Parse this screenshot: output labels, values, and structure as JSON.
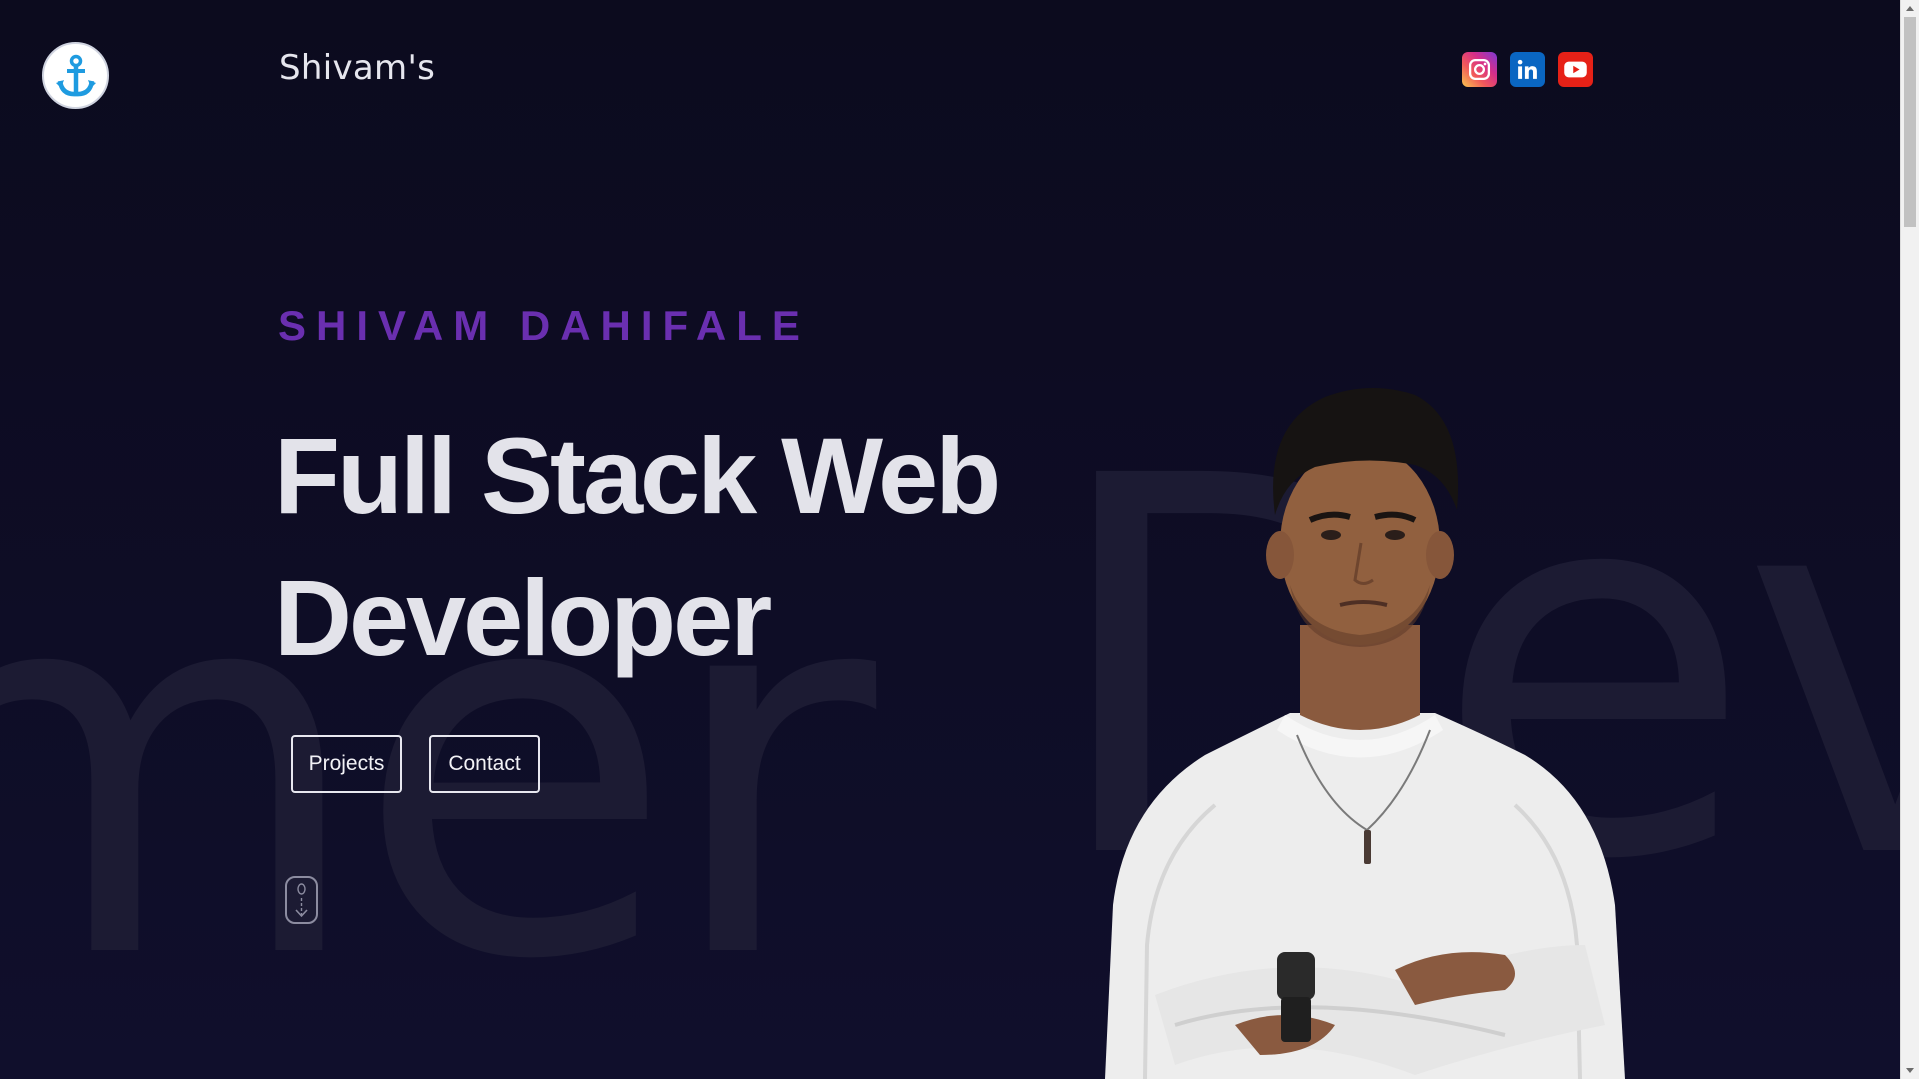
{
  "header": {
    "brand": "Shivam's",
    "logo_icon": "anchor-icon",
    "socials": [
      {
        "name": "instagram",
        "icon": "instagram-icon",
        "color": "#d62e8a"
      },
      {
        "name": "linkedin",
        "icon": "linkedin-icon",
        "color": "#0a66c2"
      },
      {
        "name": "youtube",
        "icon": "youtube-icon",
        "color": "#e62117"
      }
    ]
  },
  "hero": {
    "kicker": "SHIVAM DAHIFALE",
    "headline_line1": "Full Stack Web",
    "headline_line2": "Developer",
    "buttons": {
      "projects": "Projects",
      "contact": "Contact"
    },
    "scroll_icon": "mouse-scroll-icon",
    "background_words": {
      "left": "mer",
      "right": "Dev"
    }
  },
  "colors": {
    "background": "#0d0c21",
    "accent": "#6a2fb0",
    "headline": "#e3e3ea",
    "logo_anchor": "#1e9be0"
  }
}
